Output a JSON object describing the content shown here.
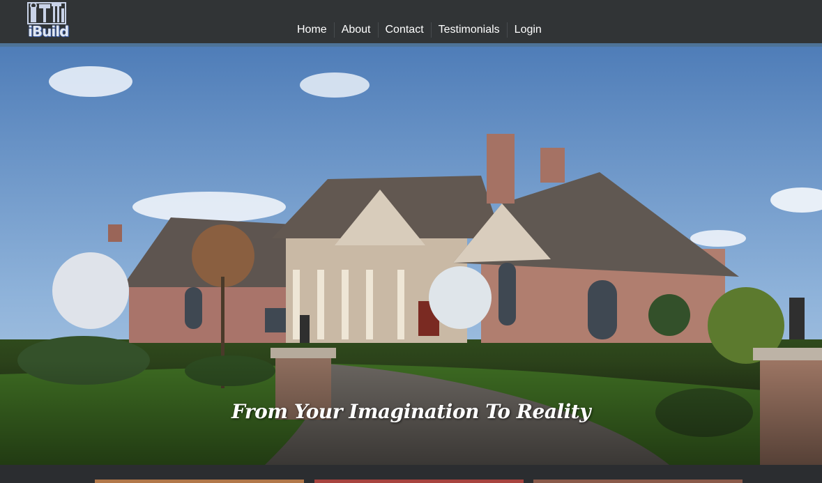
{
  "brand": {
    "name": "iBuild",
    "logo_icon": "tools-logo-icon"
  },
  "nav": {
    "items": [
      {
        "label": "Home"
      },
      {
        "label": "About"
      },
      {
        "label": "Contact"
      },
      {
        "label": "Testimonials"
      },
      {
        "label": "Login"
      }
    ]
  },
  "hero": {
    "tagline": "From Your Imagination To Reality",
    "image": "brick-mansion-photo"
  },
  "colors": {
    "navbar": "#313436",
    "accent": "#4e7397",
    "background": "#2b2d30"
  }
}
